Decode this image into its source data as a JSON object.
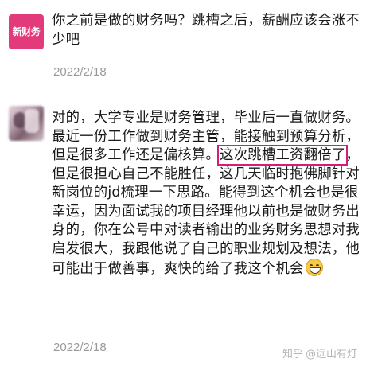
{
  "messages": [
    {
      "avatar": {
        "label": "新财务"
      },
      "text": "你之前是做的财务吗？跳槽之后，薪酬应该会涨不少吧",
      "date": "2022/2/18"
    },
    {
      "text_before": "对的，大学专业是财务管理，毕业后一直做财务。最近一份工作做到财务主管，能接触到预算分析，但是很多工作还是偏核算。",
      "highlight": "这次跳槽工资翻倍了",
      "text_after": "，但是很担心自己不能胜任，这几天临时抱佛脚针对新岗位的jd梳理一下思路。能得到这个机会也是很幸运，因为面试我的项目经理他以前也是做财务出身的，你在公号中对读者输出的业务财务思想对我启发很大，我跟他说了自己的职业规划及想法，他可能出于做善事，爽快的给了我这个机会",
      "emoji": "grin",
      "date": "2022/2/18"
    }
  ],
  "watermark": {
    "site": "知乎",
    "user": "@远山有灯"
  }
}
